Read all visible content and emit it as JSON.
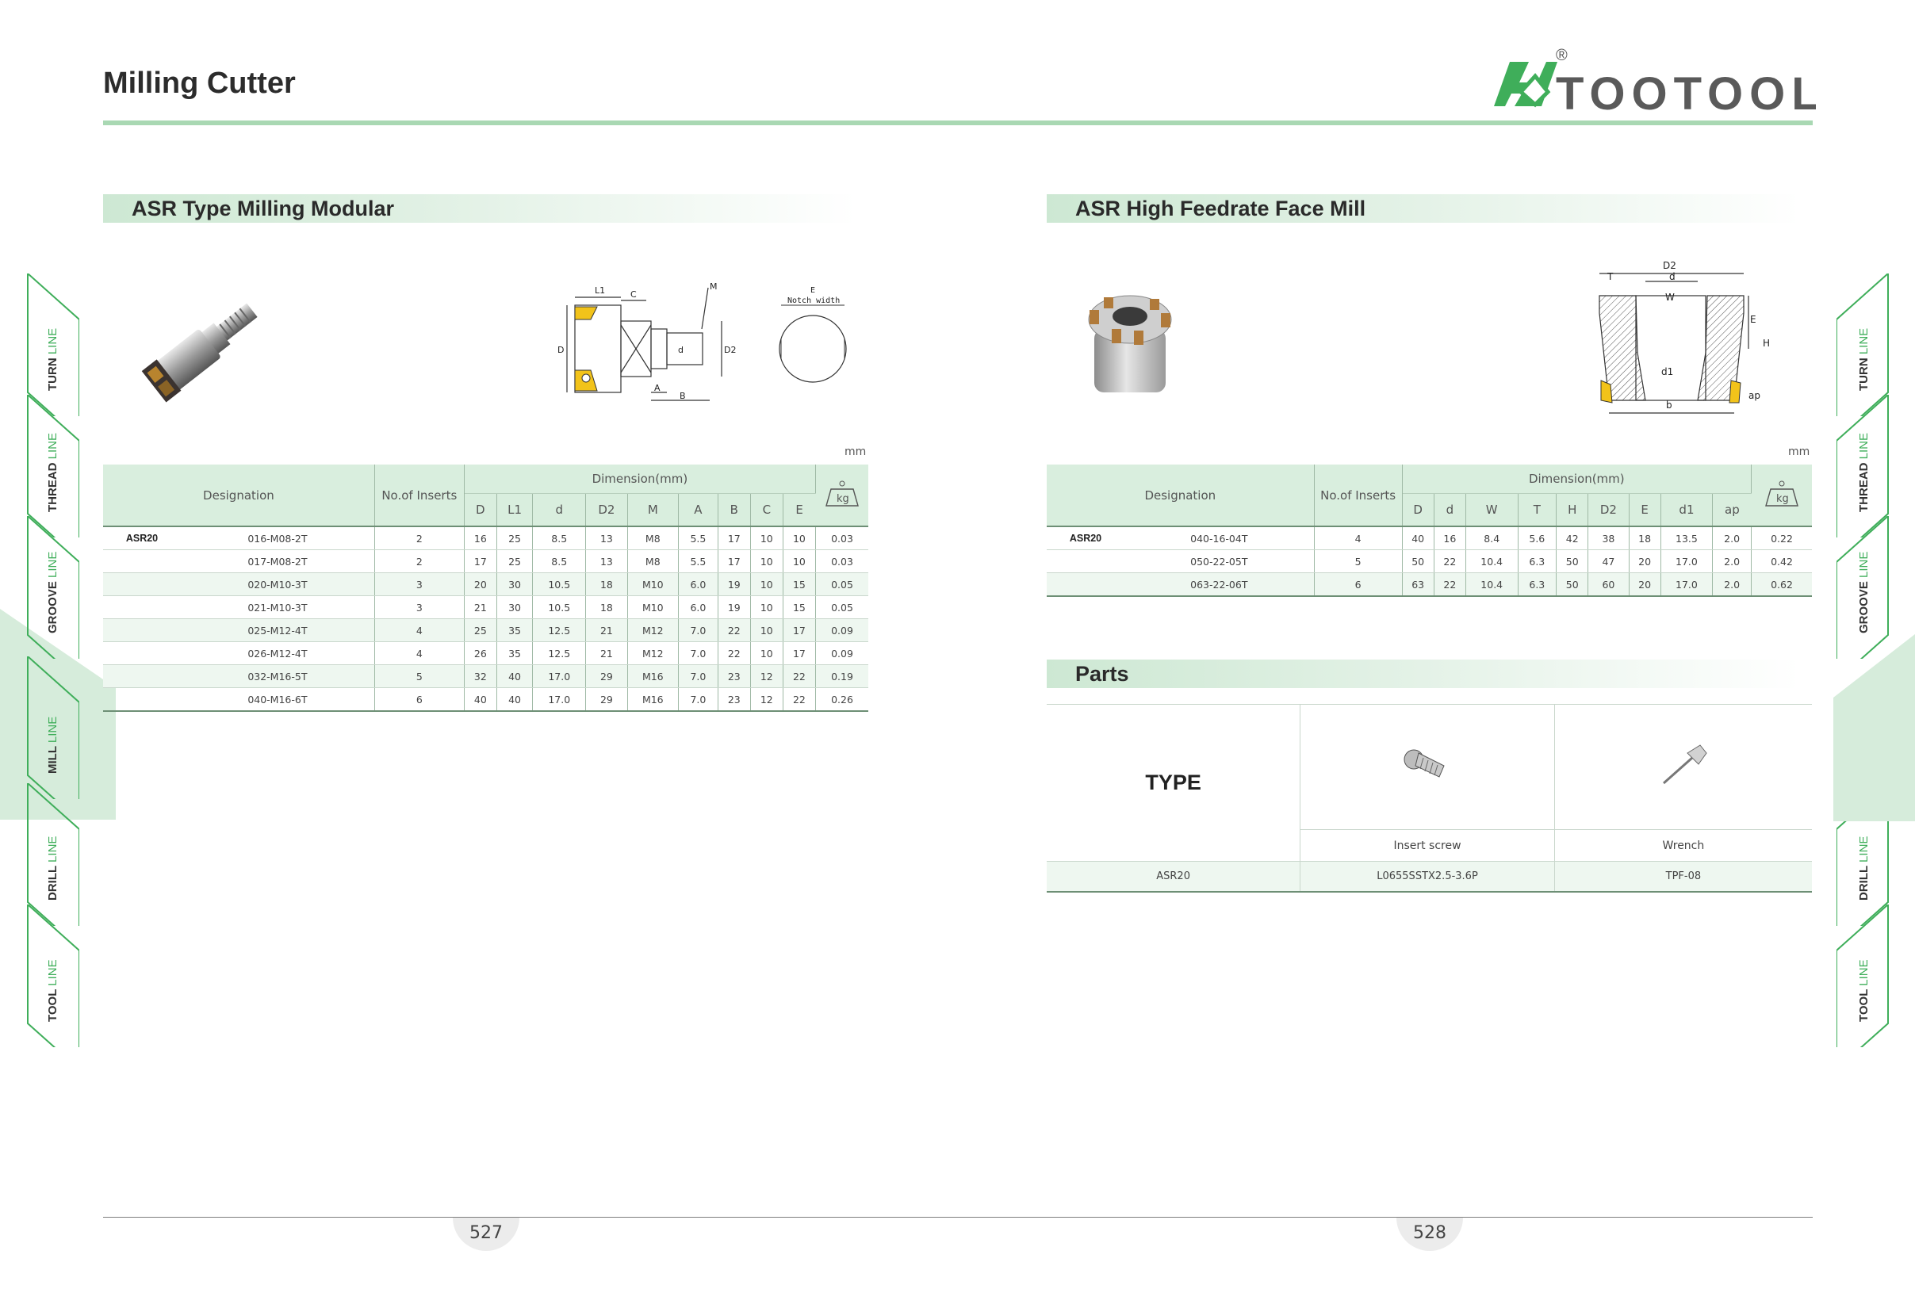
{
  "header": {
    "title": "Milling Cutter",
    "brand": "TOOTOOL",
    "registered_mark": "®"
  },
  "colors": {
    "accent": "#3fae5a",
    "band": "#cde8d3",
    "rule": "#a9d8b3"
  },
  "side_tabs": [
    {
      "word": "TURN",
      "line": "LINE"
    },
    {
      "word": "THREAD",
      "line": "LINE"
    },
    {
      "word": "GROOVE",
      "line": "LINE"
    },
    {
      "word": "MILL",
      "line": "LINE"
    },
    {
      "word": "DRILL",
      "line": "LINE"
    },
    {
      "word": "TOOL",
      "line": "LINE"
    }
  ],
  "left": {
    "section_title": "ASR Type Milling Modular",
    "diagram": {
      "L1": "L1",
      "C": "C",
      "M": "M",
      "D": "D",
      "d": "d",
      "D2": "D2",
      "A": "A",
      "B": "B",
      "E": "E",
      "notch": "Notch width"
    },
    "unit": "mm",
    "table": {
      "designation": "Designation",
      "inserts": "No.of Inserts",
      "dimension": "Dimension(mm)",
      "weight": "kg",
      "columns": [
        "D",
        "L1",
        "d",
        "D2",
        "M",
        "A",
        "B",
        "C",
        "E"
      ],
      "series": "ASR20",
      "rows": [
        {
          "code": "016-M08-2T",
          "n": "2",
          "vals": [
            "16",
            "25",
            "8.5",
            "13",
            "M8",
            "5.5",
            "17",
            "10",
            "10"
          ],
          "kg": "0.03"
        },
        {
          "code": "017-M08-2T",
          "n": "2",
          "vals": [
            "17",
            "25",
            "8.5",
            "13",
            "M8",
            "5.5",
            "17",
            "10",
            "10"
          ],
          "kg": "0.03"
        },
        {
          "code": "020-M10-3T",
          "n": "3",
          "vals": [
            "20",
            "30",
            "10.5",
            "18",
            "M10",
            "6.0",
            "19",
            "10",
            "15"
          ],
          "kg": "0.05"
        },
        {
          "code": "021-M10-3T",
          "n": "3",
          "vals": [
            "21",
            "30",
            "10.5",
            "18",
            "M10",
            "6.0",
            "19",
            "10",
            "15"
          ],
          "kg": "0.05"
        },
        {
          "code": "025-M12-4T",
          "n": "4",
          "vals": [
            "25",
            "35",
            "12.5",
            "21",
            "M12",
            "7.0",
            "22",
            "10",
            "17"
          ],
          "kg": "0.09"
        },
        {
          "code": "026-M12-4T",
          "n": "4",
          "vals": [
            "26",
            "35",
            "12.5",
            "21",
            "M12",
            "7.0",
            "22",
            "10",
            "17"
          ],
          "kg": "0.09"
        },
        {
          "code": "032-M16-5T",
          "n": "5",
          "vals": [
            "32",
            "40",
            "17.0",
            "29",
            "M16",
            "7.0",
            "23",
            "12",
            "22"
          ],
          "kg": "0.19"
        },
        {
          "code": "040-M16-6T",
          "n": "6",
          "vals": [
            "40",
            "40",
            "17.0",
            "29",
            "M16",
            "7.0",
            "23",
            "12",
            "22"
          ],
          "kg": "0.26"
        }
      ]
    },
    "page_number": "527"
  },
  "right": {
    "section_title": "ASR High Feedrate Face Mill",
    "diagram": {
      "D2": "D2",
      "d": "d",
      "T": "T",
      "W": "W",
      "E": "E",
      "H": "H",
      "d1": "d1",
      "ap": "ap",
      "b": "b"
    },
    "unit": "mm",
    "table": {
      "designation": "Designation",
      "inserts": "No.of Inserts",
      "dimension": "Dimension(mm)",
      "weight": "kg",
      "columns": [
        "D",
        "d",
        "W",
        "T",
        "H",
        "D2",
        "E",
        "d1",
        "ap"
      ],
      "series": "ASR20",
      "rows": [
        {
          "code": "040-16-04T",
          "n": "4",
          "vals": [
            "40",
            "16",
            "8.4",
            "5.6",
            "42",
            "38",
            "18",
            "13.5",
            "2.0"
          ],
          "kg": "0.22"
        },
        {
          "code": "050-22-05T",
          "n": "5",
          "vals": [
            "50",
            "22",
            "10.4",
            "6.3",
            "50",
            "47",
            "20",
            "17.0",
            "2.0"
          ],
          "kg": "0.42"
        },
        {
          "code": "063-22-06T",
          "n": "6",
          "vals": [
            "63",
            "22",
            "10.4",
            "6.3",
            "50",
            "60",
            "20",
            "17.0",
            "2.0"
          ],
          "kg": "0.62"
        }
      ]
    },
    "parts": {
      "title": "Parts",
      "type_label": "TYPE",
      "col1": "Insert screw",
      "col2": "Wrench",
      "row": {
        "type": "ASR20",
        "screw": "L0655SSTX2.5-3.6P",
        "wrench": "TPF-08"
      }
    },
    "page_number": "528"
  }
}
